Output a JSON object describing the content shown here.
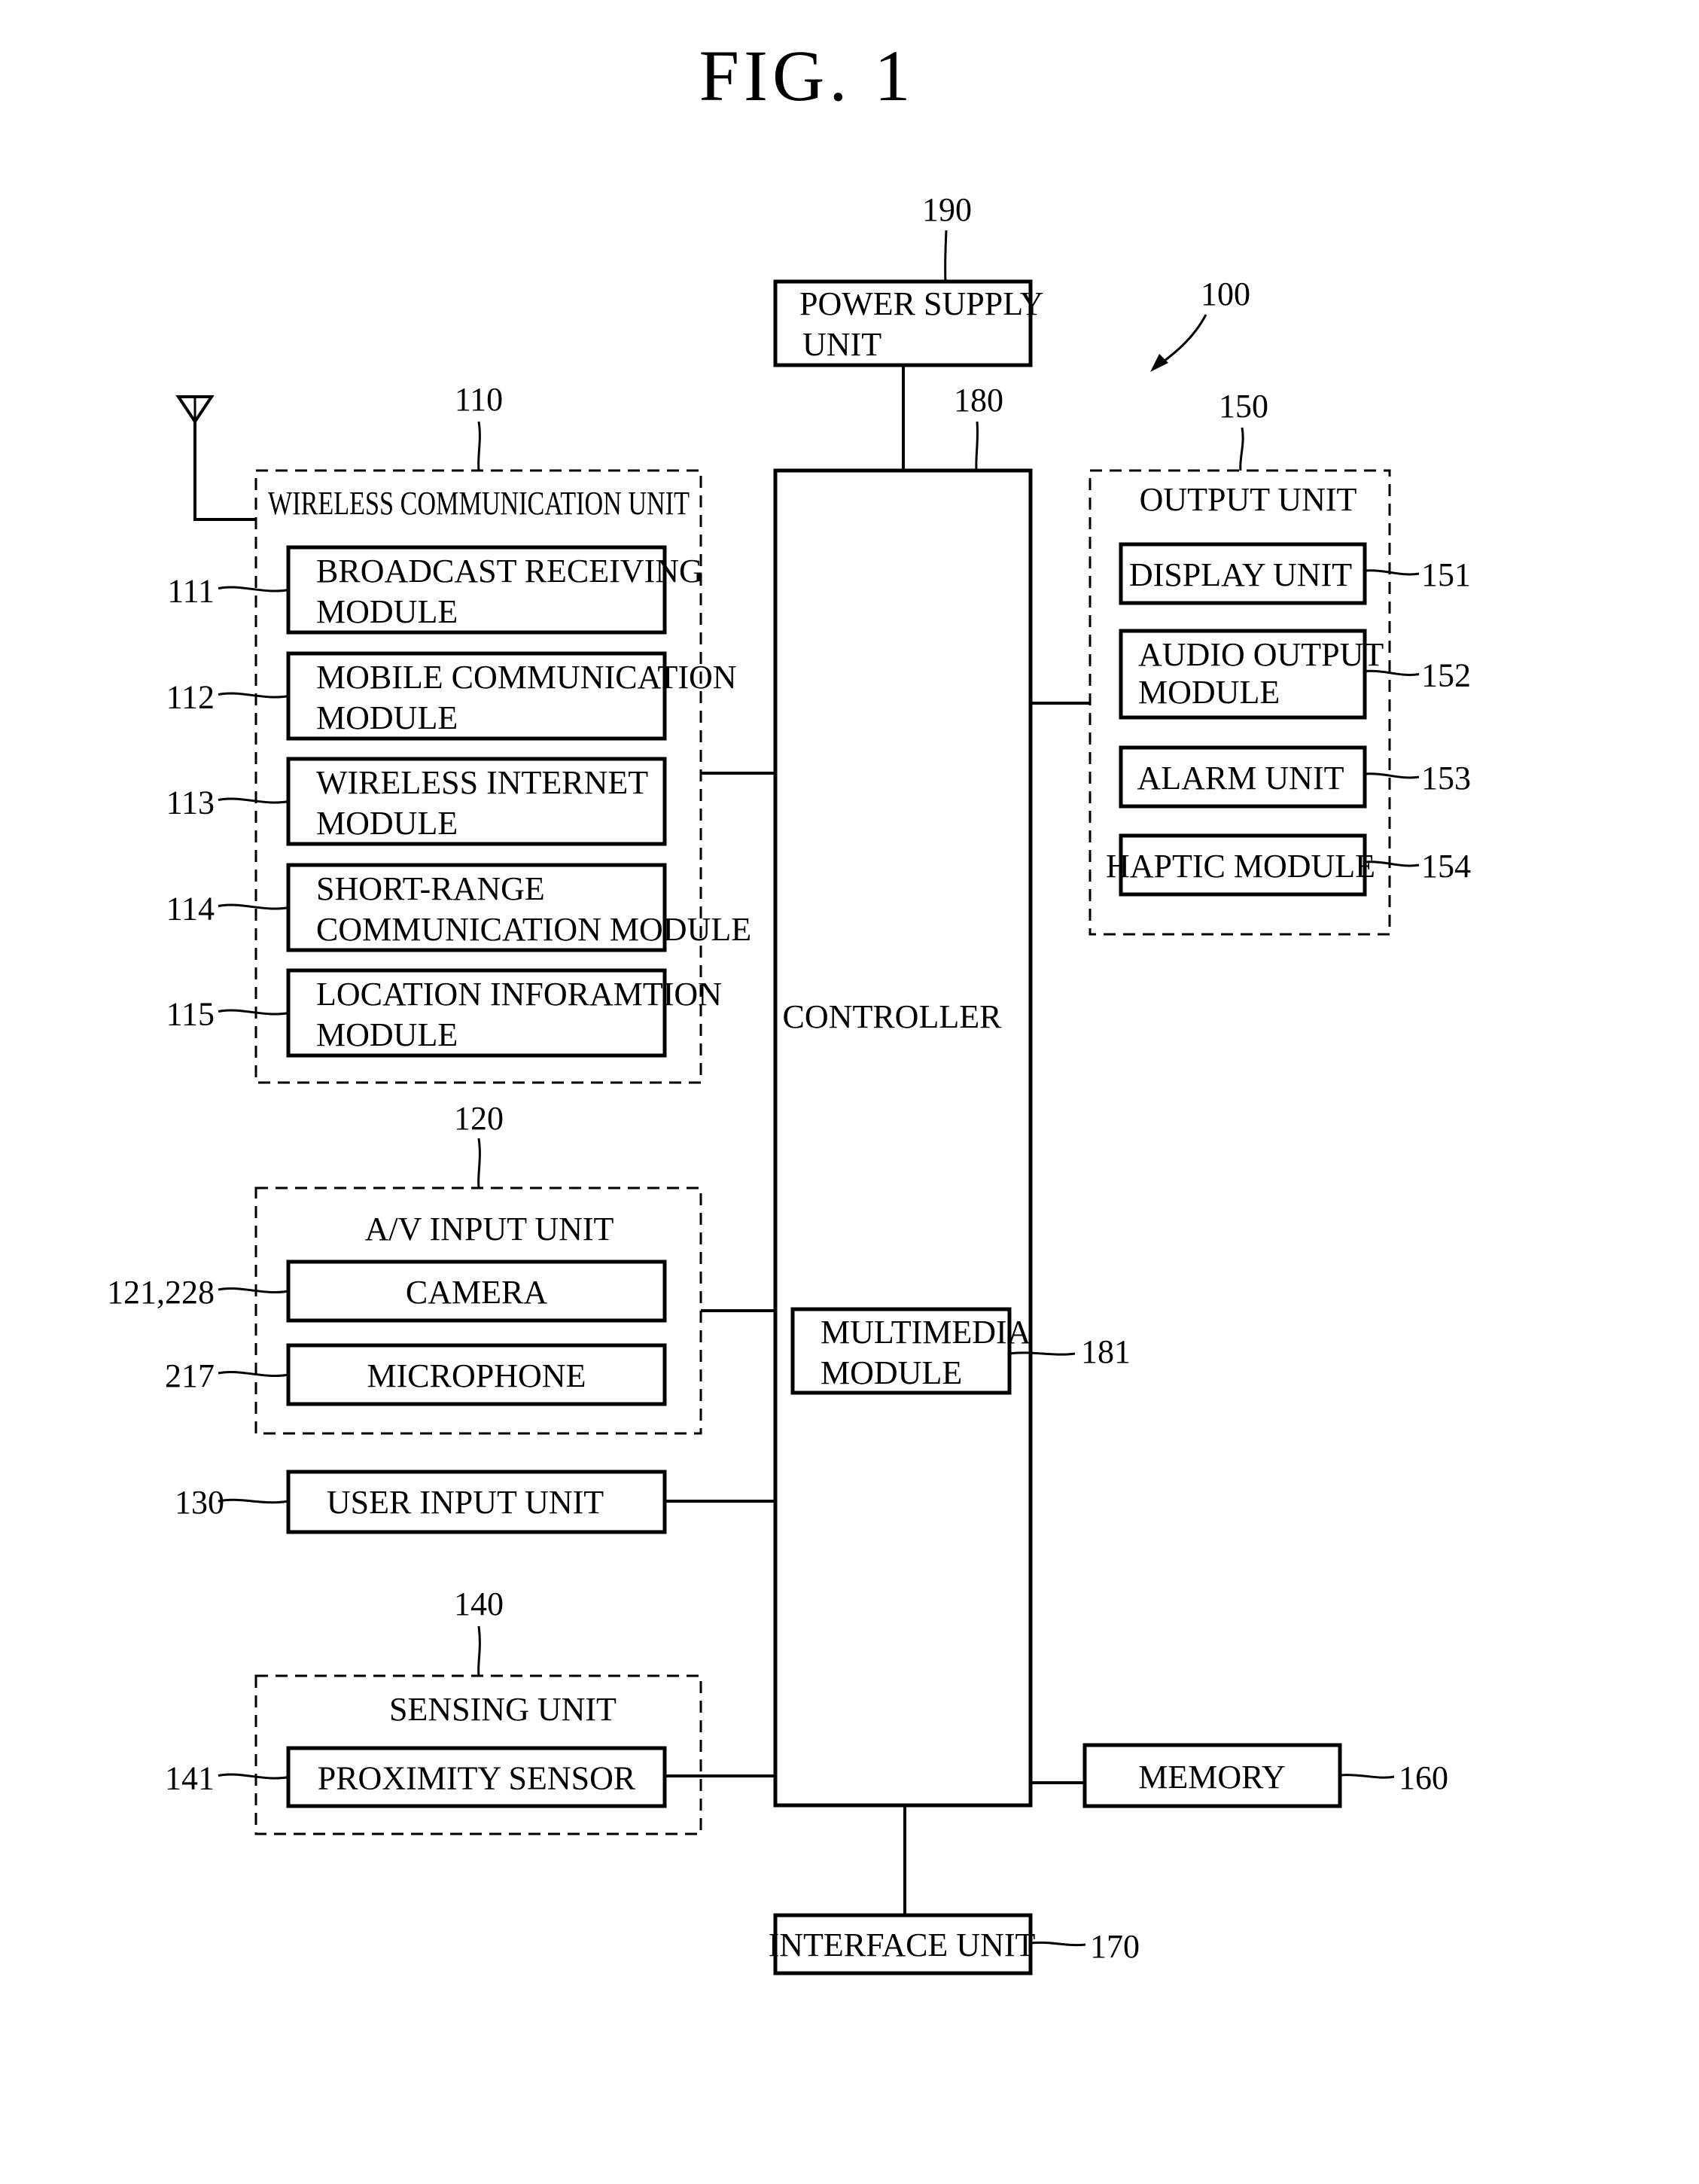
{
  "figure": {
    "title": "FIG. 1",
    "device_ref": "100"
  },
  "power_supply": {
    "ref": "190",
    "lines": [
      "POWER SUPPLY",
      "UNIT"
    ]
  },
  "controller": {
    "ref": "180",
    "label": "CONTROLLER",
    "multimedia": {
      "ref": "181",
      "lines": [
        "MULTIMEDIA",
        "MODULE"
      ]
    }
  },
  "wireless": {
    "ref": "110",
    "title": "WIRELESS COMMUNICATION UNIT",
    "modules": [
      {
        "ref": "111",
        "lines": [
          "BROADCAST RECEIVING",
          "MODULE"
        ]
      },
      {
        "ref": "112",
        "lines": [
          "MOBILE COMMUNICATION",
          "MODULE"
        ]
      },
      {
        "ref": "113",
        "lines": [
          "WIRELESS INTERNET",
          "MODULE"
        ]
      },
      {
        "ref": "114",
        "lines": [
          "SHORT-RANGE",
          "COMMUNICATION MODULE"
        ]
      },
      {
        "ref": "115",
        "lines": [
          "LOCATION INFORAMTION",
          "MODULE"
        ]
      }
    ]
  },
  "av_input": {
    "ref": "120",
    "title": "A/V INPUT UNIT",
    "modules": [
      {
        "ref": "121,228",
        "label": "CAMERA"
      },
      {
        "ref": "217",
        "label": "MICROPHONE"
      }
    ]
  },
  "user_input": {
    "ref": "130",
    "label": "USER INPUT UNIT"
  },
  "sensing": {
    "ref": "140",
    "title": "SENSING UNIT",
    "modules": [
      {
        "ref": "141",
        "label": "PROXIMITY SENSOR"
      }
    ]
  },
  "output": {
    "ref": "150",
    "title": "OUTPUT UNIT",
    "modules": [
      {
        "ref": "151",
        "lines": [
          "DISPLAY UNIT"
        ]
      },
      {
        "ref": "152",
        "lines": [
          "AUDIO OUTPUT",
          "MODULE"
        ]
      },
      {
        "ref": "153",
        "lines": [
          "ALARM UNIT"
        ]
      },
      {
        "ref": "154",
        "lines": [
          "HAPTIC MODULE"
        ]
      }
    ]
  },
  "memory": {
    "ref": "160",
    "label": "MEMORY"
  },
  "interface": {
    "ref": "170",
    "label": "INTERFACE UNIT"
  }
}
